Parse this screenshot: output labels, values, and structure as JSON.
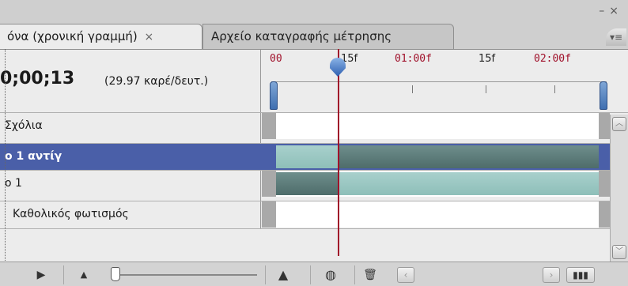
{
  "window": {
    "minimize_glyph": "–",
    "close_glyph": "×"
  },
  "tabs": [
    {
      "label": "όνα (χρονική γραμμή)",
      "close": "×",
      "active": true
    },
    {
      "label": "Αρχείο καταγραφής μέτρησης",
      "active": false
    }
  ],
  "panel_menu_icon": "panel-menu-icon",
  "header": {
    "timecode": "0;00;13",
    "fps": "(29.97 καρέ/δευτ.)"
  },
  "ruler": {
    "labels": [
      "00",
      "15f",
      "01:00f",
      "15f",
      "02:00f"
    ]
  },
  "layers": [
    {
      "label": "Σχόλια",
      "selected": false
    },
    {
      "label": "ο 1 αντίγ",
      "selected": true
    },
    {
      "label": "ο 1",
      "selected": false
    },
    {
      "label": "Καθολικός φωτισμός",
      "selected": false
    }
  ],
  "bottom_toolbar": {
    "icons": [
      "play-frames-icon",
      "zoom-out-icon",
      "zoom-slider",
      "zoom-in-icon",
      "tween-icon",
      "trash-icon",
      "scroll-left-icon",
      "scroll-right-icon",
      "frames-view-icon"
    ]
  },
  "colors": {
    "selection": "#4a5fa8",
    "playhead": "#a0102a",
    "clip_light": "#a8d0cc",
    "clip_dark": "#5e7e7c"
  }
}
